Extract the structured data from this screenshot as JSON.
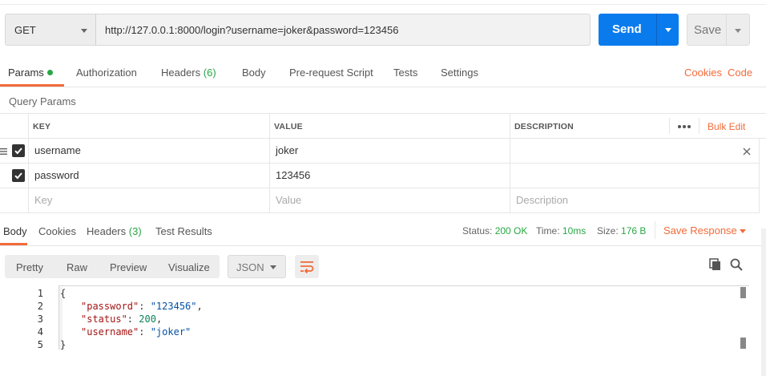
{
  "request": {
    "method": "GET",
    "url": "http://127.0.0.1:8000/login?username=joker&password=123456",
    "send_label": "Send",
    "save_label": "Save"
  },
  "request_tabs": {
    "params": "Params",
    "authorization": "Authorization",
    "headers": "Headers",
    "headers_count": "(6)",
    "body": "Body",
    "pre_request": "Pre-request Script",
    "tests": "Tests",
    "settings": "Settings",
    "cookies": "Cookies",
    "code": "Code"
  },
  "query_params": {
    "title": "Query Params",
    "columns": {
      "key": "KEY",
      "value": "VALUE",
      "description": "DESCRIPTION"
    },
    "bulk_edit": "Bulk Edit",
    "rows": [
      {
        "key": "username",
        "value": "joker",
        "checked": true
      },
      {
        "key": "password",
        "value": "123456",
        "checked": true
      }
    ],
    "placeholders": {
      "key": "Key",
      "value": "Value",
      "description": "Description"
    }
  },
  "response_tabs": {
    "body": "Body",
    "cookies": "Cookies",
    "headers": "Headers",
    "headers_count": "(3)",
    "test_results": "Test Results"
  },
  "response_status": {
    "status_label": "Status:",
    "status_value": "200 OK",
    "time_label": "Time:",
    "time_value": "10ms",
    "size_label": "Size:",
    "size_value": "176 B",
    "save_response": "Save Response"
  },
  "body_toolbar": {
    "pretty": "Pretty",
    "raw": "Raw",
    "preview": "Preview",
    "visualize": "Visualize",
    "format": "JSON"
  },
  "response_body": {
    "line_numbers": [
      "1",
      "2",
      "3",
      "4",
      "5"
    ],
    "open_brace": "{",
    "close_brace": "}",
    "fields": [
      {
        "key": "\"password\"",
        "value": "\"123456\"",
        "type": "string",
        "comma": ","
      },
      {
        "key": "\"status\"",
        "value": "200",
        "type": "number",
        "comma": ","
      },
      {
        "key": "\"username\"",
        "value": "\"joker\"",
        "type": "string",
        "comma": ""
      }
    ]
  }
}
